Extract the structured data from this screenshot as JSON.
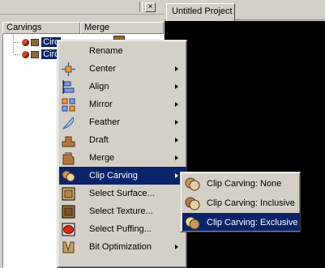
{
  "panel": {
    "columns": [
      "Carvings",
      "Merge"
    ],
    "rows": [
      {
        "label": "Circ"
      },
      {
        "label": "Circ"
      }
    ]
  },
  "tab": {
    "label": "Untitled Project"
  },
  "menu": {
    "items": [
      {
        "label": "Rename",
        "icon": "none",
        "submenu": false
      },
      {
        "label": "Center",
        "icon": "center-crosshair-icon",
        "submenu": true
      },
      {
        "label": "Align",
        "icon": "align-icon",
        "submenu": true
      },
      {
        "label": "Mirror",
        "icon": "mirror-icon",
        "submenu": true
      },
      {
        "label": "Feather",
        "icon": "feather-icon",
        "submenu": true
      },
      {
        "label": "Draft",
        "icon": "draft-icon",
        "submenu": true
      },
      {
        "label": "Merge",
        "icon": "merge-icon",
        "submenu": true
      },
      {
        "label": "Clip Carving",
        "icon": "clip-carving-icon",
        "submenu": true,
        "highlighted": true
      },
      {
        "label": "Select Surface...",
        "icon": "select-surface-icon",
        "submenu": false
      },
      {
        "label": "Select Texture...",
        "icon": "select-texture-icon",
        "submenu": false
      },
      {
        "label": "Select Puffing...",
        "icon": "select-puffing-icon",
        "submenu": false
      },
      {
        "label": "Bit Optimization",
        "icon": "bit-optimization-icon",
        "submenu": true
      }
    ]
  },
  "submenu": {
    "items": [
      {
        "label": "Clip Carving: None"
      },
      {
        "label": "Clip Carving: Inclusive"
      },
      {
        "label": "Clip Carving: Exclusive",
        "highlighted": true
      }
    ]
  },
  "colors": {
    "selection": "#0a246a",
    "face": "#d4d0c8",
    "viewport": "#000000"
  }
}
